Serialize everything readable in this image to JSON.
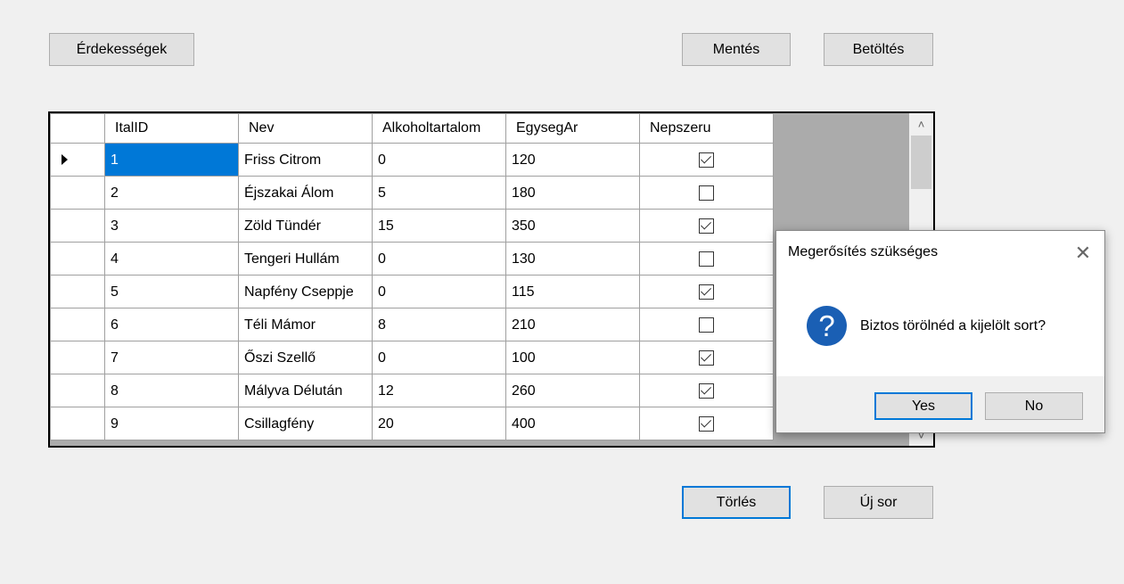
{
  "toolbar": {
    "erdekessegek_label": "Érdekességek",
    "mentes_label": "Mentés",
    "betoltes_label": "Betöltés"
  },
  "grid": {
    "columns": [
      "ItalID",
      "Nev",
      "Alkoholtartalom",
      "EgysegAr",
      "Nepszeru"
    ],
    "rows": [
      {
        "id": "1",
        "nev": "Friss Citrom",
        "alkohol": "0",
        "ar": "120",
        "nepszeru": true
      },
      {
        "id": "2",
        "nev": "Éjszakai Álom",
        "alkohol": "5",
        "ar": "180",
        "nepszeru": false
      },
      {
        "id": "3",
        "nev": "Zöld Tündér",
        "alkohol": "15",
        "ar": "350",
        "nepszeru": true
      },
      {
        "id": "4",
        "nev": "Tengeri Hullám",
        "alkohol": "0",
        "ar": "130",
        "nepszeru": false
      },
      {
        "id": "5",
        "nev": "Napfény Cseppje",
        "alkohol": "0",
        "ar": "115",
        "nepszeru": true
      },
      {
        "id": "6",
        "nev": "Téli Mámor",
        "alkohol": "8",
        "ar": "210",
        "nepszeru": false
      },
      {
        "id": "7",
        "nev": "Őszi Szellő",
        "alkohol": "0",
        "ar": "100",
        "nepszeru": true
      },
      {
        "id": "8",
        "nev": "Mályva Délután",
        "alkohol": "12",
        "ar": "260",
        "nepszeru": true
      },
      {
        "id": "9",
        "nev": "Csillagfény",
        "alkohol": "20",
        "ar": "400",
        "nepszeru": true
      }
    ],
    "selected_row": 0
  },
  "actions": {
    "torles_label": "Törlés",
    "ujsor_label": "Új sor"
  },
  "dialog": {
    "title": "Megerősítés szükséges",
    "message": "Biztos törölnéd a kijelölt sort?",
    "icon": "question-icon",
    "yes_label": "Yes",
    "no_label": "No"
  },
  "colors": {
    "selection": "#0078d7",
    "window_bg": "#f0f0f0",
    "grid_empty_bg": "#ababab"
  }
}
